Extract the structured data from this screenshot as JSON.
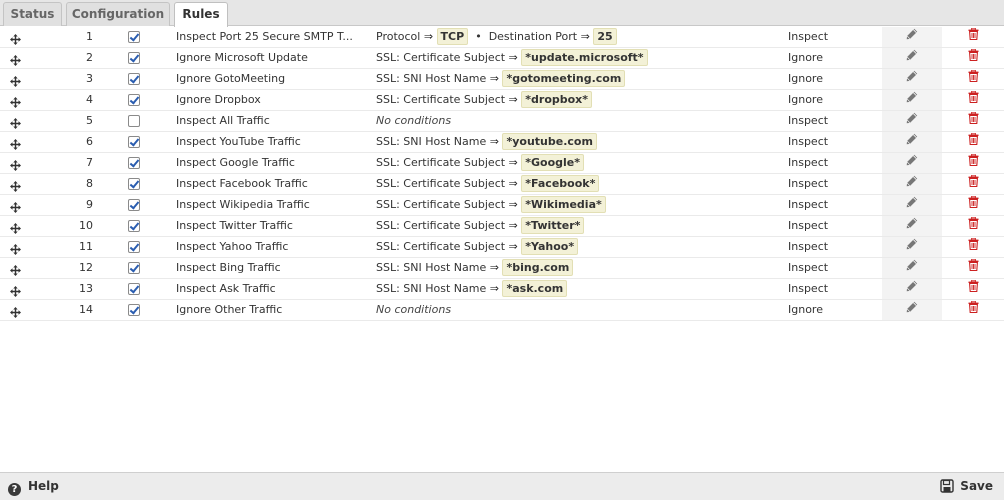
{
  "tabs": [
    {
      "label": "Status",
      "active": false
    },
    {
      "label": "Configuration",
      "active": false
    },
    {
      "label": "Rules",
      "active": true
    }
  ],
  "no_conditions_label": "No conditions",
  "rules": [
    {
      "num": "1",
      "enabled": true,
      "name": "Inspect Port 25 Secure SMTP T...",
      "conditions": [
        {
          "key": "Protocol ⇒",
          "value": "TCP"
        },
        {
          "key": "Destination Port ⇒",
          "value": "25"
        }
      ],
      "action": "Inspect"
    },
    {
      "num": "2",
      "enabled": true,
      "name": "Ignore Microsoft Update",
      "conditions": [
        {
          "key": "SSL: Certificate Subject ⇒",
          "value": "*update.microsoft*"
        }
      ],
      "action": "Ignore"
    },
    {
      "num": "3",
      "enabled": true,
      "name": "Ignore GotoMeeting",
      "conditions": [
        {
          "key": "SSL: SNI Host Name ⇒",
          "value": "*gotomeeting.com"
        }
      ],
      "action": "Ignore"
    },
    {
      "num": "4",
      "enabled": true,
      "name": "Ignore Dropbox",
      "conditions": [
        {
          "key": "SSL: Certificate Subject ⇒",
          "value": "*dropbox*"
        }
      ],
      "action": "Ignore"
    },
    {
      "num": "5",
      "enabled": false,
      "name": "Inspect All Traffic",
      "conditions": [],
      "action": "Inspect"
    },
    {
      "num": "6",
      "enabled": true,
      "name": "Inspect YouTube Traffic",
      "conditions": [
        {
          "key": "SSL: SNI Host Name ⇒",
          "value": "*youtube.com"
        }
      ],
      "action": "Inspect"
    },
    {
      "num": "7",
      "enabled": true,
      "name": "Inspect Google Traffic",
      "conditions": [
        {
          "key": "SSL: Certificate Subject ⇒",
          "value": "*Google*"
        }
      ],
      "action": "Inspect"
    },
    {
      "num": "8",
      "enabled": true,
      "name": "Inspect Facebook Traffic",
      "conditions": [
        {
          "key": "SSL: Certificate Subject ⇒",
          "value": "*Facebook*"
        }
      ],
      "action": "Inspect"
    },
    {
      "num": "9",
      "enabled": true,
      "name": "Inspect Wikipedia Traffic",
      "conditions": [
        {
          "key": "SSL: Certificate Subject ⇒",
          "value": "*Wikimedia*"
        }
      ],
      "action": "Inspect"
    },
    {
      "num": "10",
      "enabled": true,
      "name": "Inspect Twitter Traffic",
      "conditions": [
        {
          "key": "SSL: Certificate Subject ⇒",
          "value": "*Twitter*"
        }
      ],
      "action": "Inspect"
    },
    {
      "num": "11",
      "enabled": true,
      "name": "Inspect Yahoo Traffic",
      "conditions": [
        {
          "key": "SSL: Certificate Subject ⇒",
          "value": "*Yahoo*"
        }
      ],
      "action": "Inspect"
    },
    {
      "num": "12",
      "enabled": true,
      "name": "Inspect Bing Traffic",
      "conditions": [
        {
          "key": "SSL: SNI Host Name ⇒",
          "value": "*bing.com"
        }
      ],
      "action": "Inspect"
    },
    {
      "num": "13",
      "enabled": true,
      "name": "Inspect Ask Traffic",
      "conditions": [
        {
          "key": "SSL: SNI Host Name ⇒",
          "value": "*ask.com"
        }
      ],
      "action": "Inspect"
    },
    {
      "num": "14",
      "enabled": true,
      "name": "Ignore Other Traffic",
      "conditions": [],
      "action": "Ignore"
    }
  ],
  "icons": {
    "drag": "move-arrows-icon",
    "edit": "pencil-icon",
    "delete": "trash-icon",
    "help": "question-circle-icon",
    "save": "floppy-disk-icon"
  },
  "colors": {
    "delete_icon": "#cc2020",
    "pill_bg": "#f3f1d7",
    "checkbox_check": "#2a5db0"
  },
  "footer": {
    "help_label": "Help",
    "save_label": "Save"
  }
}
